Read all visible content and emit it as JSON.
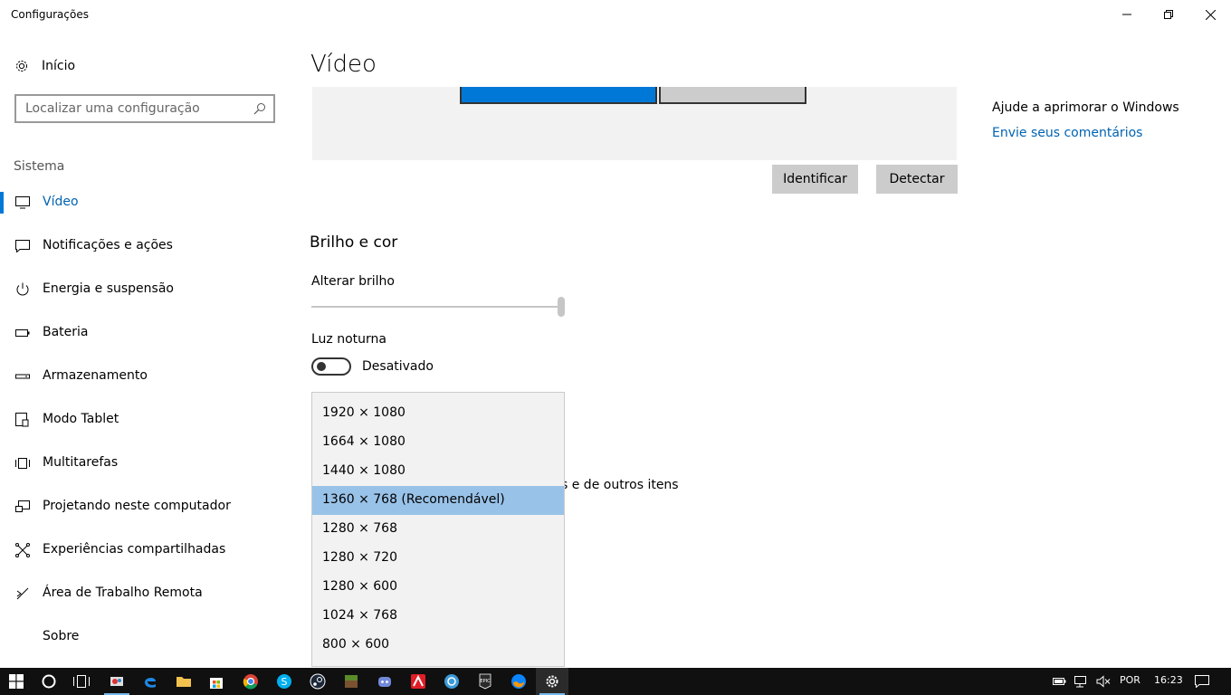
{
  "window": {
    "title": "Configurações"
  },
  "sidebar": {
    "home_label": "Início",
    "search_placeholder": "Localizar uma configuração",
    "group_header": "Sistema",
    "items": [
      {
        "label": "Vídeo",
        "icon": "monitor-icon",
        "active": true
      },
      {
        "label": "Notificações e ações",
        "icon": "notification-icon"
      },
      {
        "label": "Energia e suspensão",
        "icon": "power-icon"
      },
      {
        "label": "Bateria",
        "icon": "battery-icon"
      },
      {
        "label": "Armazenamento",
        "icon": "storage-icon"
      },
      {
        "label": "Modo Tablet",
        "icon": "tablet-icon"
      },
      {
        "label": "Multitarefas",
        "icon": "multitask-icon"
      },
      {
        "label": "Projetando neste computador",
        "icon": "projecting-icon"
      },
      {
        "label": "Experiências compartilhadas",
        "icon": "shared-experiences-icon"
      },
      {
        "label": "Área de Trabalho Remota",
        "icon": "remote-desktop-icon"
      },
      {
        "label": "Sobre",
        "icon": "info-icon"
      }
    ]
  },
  "main": {
    "title": "Vídeo",
    "identify_label": "Identificar",
    "detect_label": "Detectar",
    "brightness_section": "Brilho e cor",
    "brightness_label": "Alterar brilho",
    "brightness_level": 1.0,
    "night_light_label": "Luz noturna",
    "night_light_state": "Desativado",
    "partial_text": "s e de outros itens"
  },
  "help": {
    "title": "Ajude a aprimorar o Windows",
    "link": "Envie seus comentários"
  },
  "resolution_dropdown": {
    "options": [
      "1920 × 1080",
      "1664 × 1080",
      "1440 × 1080",
      "1360 × 768 (Recomendável)",
      "1280 × 768",
      "1280 × 720",
      "1280 × 600",
      "1024 × 768",
      "800 × 600"
    ],
    "selected_index": 3
  },
  "taskbar": {
    "language": "POR",
    "time": "16:23",
    "accent": "#76b9ed"
  }
}
